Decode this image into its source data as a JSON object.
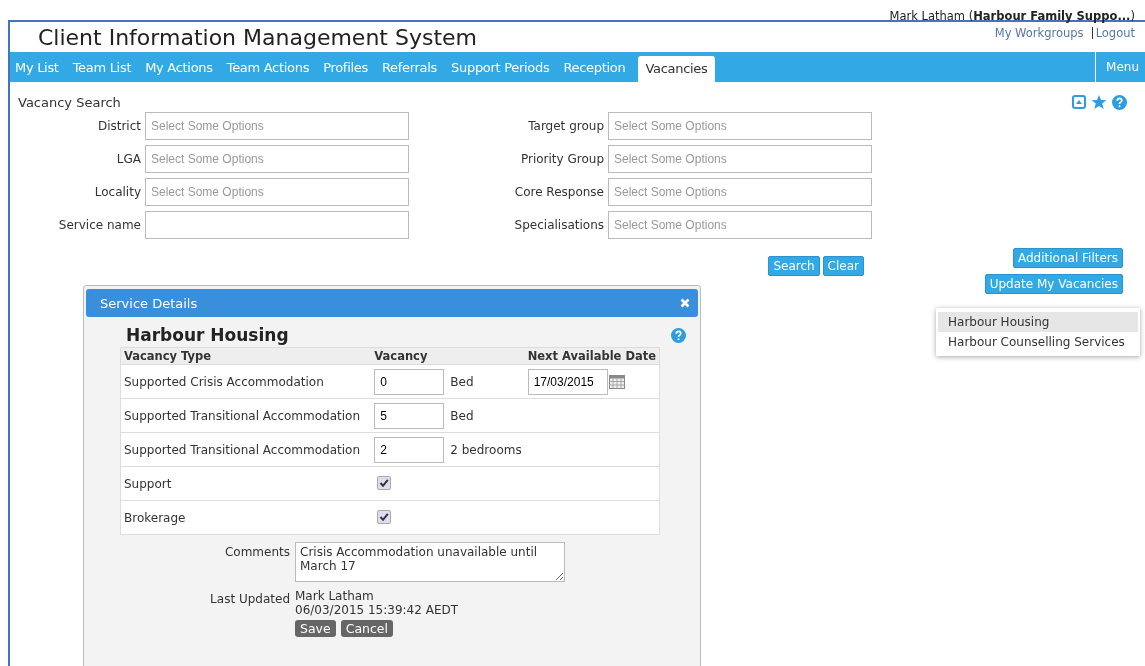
{
  "header": {
    "title": "Client Information Management System",
    "user": "Mark Latham (",
    "org": "Harbour Family Suppo...",
    "user_end": ")",
    "links": [
      "My Workgroups",
      "Logout"
    ]
  },
  "nav": {
    "tabs": [
      {
        "label": "My List",
        "selected": false
      },
      {
        "label": "Team List",
        "selected": false
      },
      {
        "label": "My Actions",
        "selected": false
      },
      {
        "label": "Team Actions",
        "selected": false
      },
      {
        "label": "Profiles",
        "selected": false
      },
      {
        "label": "Referrals",
        "selected": false
      },
      {
        "label": "Support Periods",
        "selected": false
      },
      {
        "label": "Reception",
        "selected": false
      },
      {
        "label": "Vacancies",
        "selected": true
      }
    ],
    "menu": "Menu"
  },
  "search": {
    "title": "Vacancy Search",
    "left_fields": [
      {
        "label": "District",
        "placeholder": "Select Some Options"
      },
      {
        "label": "LGA",
        "placeholder": "Select Some Options"
      },
      {
        "label": "Locality",
        "placeholder": "Select Some Options"
      },
      {
        "label": "Service name"
      }
    ],
    "right_fields": [
      {
        "label": "Target group",
        "placeholder": "Select Some Options"
      },
      {
        "label": "Priority Group",
        "placeholder": "Select Some Options"
      },
      {
        "label": "Core Response",
        "placeholder": "Select Some Options"
      },
      {
        "label": "Specialisations",
        "placeholder": "Select Some Options"
      }
    ],
    "buttons": [
      "Search",
      "Clear"
    ],
    "side_buttons": [
      "Additional Filters",
      "Update My Vacancies"
    ]
  },
  "dropdown": {
    "items": [
      {
        "label": "Harbour Housing",
        "selected": true
      },
      {
        "label": "Harbour Counselling Services",
        "selected": false
      }
    ]
  },
  "dialog": {
    "title": "Service Details",
    "service": "Harbour Housing",
    "columns": [
      "Vacancy Type",
      "Vacancy",
      "Next Available Date"
    ],
    "rows": [
      {
        "kind": "input",
        "type": "Supported Crisis Accommodation",
        "value": "0",
        "unit": "Bed",
        "date": "17/03/2015"
      },
      {
        "kind": "input",
        "type": "Supported Transitional Accommodation",
        "value": "5",
        "unit": "Bed"
      },
      {
        "kind": "input",
        "type": "Supported Transitional Accommodation",
        "value": "2",
        "unit": "2 bedrooms"
      },
      {
        "kind": "check",
        "type": "Support",
        "checked": true
      },
      {
        "kind": "check",
        "type": "Brokerage",
        "checked": true
      }
    ],
    "comments_label": "Comments",
    "comments": "Crisis Accommodation unavailable until March 17",
    "updated_label": "Last Updated",
    "updated_by": "Mark Latham",
    "updated_at": "06/03/2015 15:39:42 AEDT",
    "buttons": [
      "Save",
      "Cancel"
    ]
  }
}
